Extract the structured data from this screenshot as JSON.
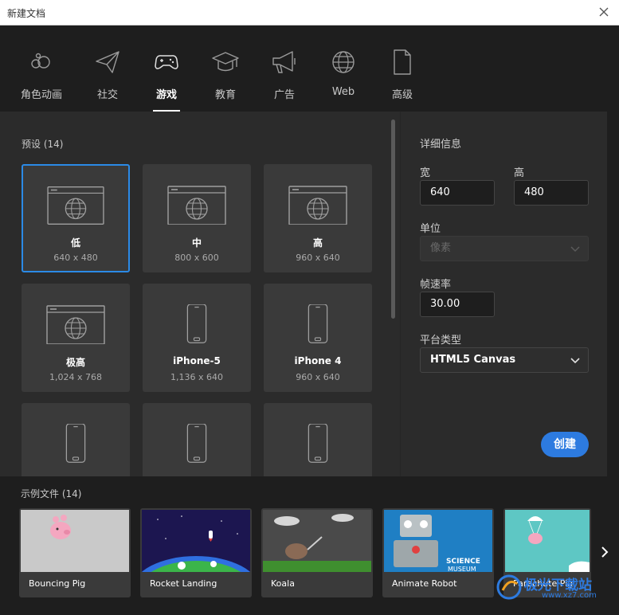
{
  "window": {
    "title": "新建文档"
  },
  "tabs": [
    {
      "label": "角色动画",
      "icon": "character-animation-icon"
    },
    {
      "label": "社交",
      "icon": "paper-plane-icon"
    },
    {
      "label": "游戏",
      "icon": "gamepad-icon",
      "active": true
    },
    {
      "label": "教育",
      "icon": "graduation-cap-icon"
    },
    {
      "label": "广告",
      "icon": "megaphone-icon"
    },
    {
      "label": "Web",
      "icon": "globe-icon"
    },
    {
      "label": "高级",
      "icon": "document-icon"
    }
  ],
  "presets": {
    "title": "预设 (14)",
    "cards": [
      {
        "name": "低",
        "size": "640 x 480",
        "icon": "browser-globe-icon"
      },
      {
        "name": "中",
        "size": "800 x 600",
        "icon": "browser-globe-icon"
      },
      {
        "name": "高",
        "size": "960 x 640",
        "icon": "browser-globe-icon"
      },
      {
        "name": "极高",
        "size": "1,024 x 768",
        "icon": "browser-globe-icon"
      },
      {
        "name": "iPhone-5",
        "size": "1,136 x 640",
        "icon": "phone-icon"
      },
      {
        "name": "iPhone 4",
        "size": "960 x 640",
        "icon": "phone-icon"
      },
      {
        "name": "",
        "size": "",
        "icon": "phone-icon"
      },
      {
        "name": "",
        "size": "",
        "icon": "phone-icon"
      },
      {
        "name": "",
        "size": "",
        "icon": "phone-icon"
      }
    ]
  },
  "details": {
    "title": "详细信息",
    "width_label": "宽",
    "width_value": "640",
    "height_label": "高",
    "height_value": "480",
    "unit_label": "单位",
    "unit_value": "像素",
    "fps_label": "帧速率",
    "fps_value": "30.00",
    "platform_label": "平台类型",
    "platform_value": "HTML5 Canvas",
    "create_label": "创建"
  },
  "examples": {
    "title": "示例文件 (14)",
    "items": [
      {
        "name": "Bouncing Pig"
      },
      {
        "name": "Rocket Landing"
      },
      {
        "name": "Koala"
      },
      {
        "name": "Animate Robot",
        "badge_line1": "SCIENCE",
        "badge_line2": "MUSEUM"
      },
      {
        "name": "Parachute Pig"
      }
    ]
  },
  "watermark": {
    "text": "极光下载站",
    "url": "www.xz7.com"
  },
  "colors": {
    "accent": "#2d7be0",
    "panel": "#2b2b2b",
    "card": "#3a3a3a",
    "background": "#1e1e1e"
  }
}
